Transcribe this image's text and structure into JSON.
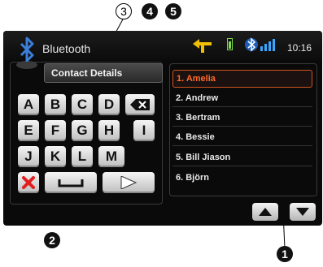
{
  "callouts": {
    "c1": "1",
    "c2": "2",
    "c3": "3",
    "c4": "4",
    "c5": "5"
  },
  "status_bar": {
    "title": "Bluetooth",
    "clock": "10:16",
    "icons": [
      "bluetooth-logo",
      "turn-arrow",
      "battery",
      "bluetooth-signal"
    ]
  },
  "header_field": "Contact Details",
  "keyboard": {
    "row1": [
      "A",
      "B",
      "C",
      "D"
    ],
    "row2": [
      "E",
      "F",
      "G",
      "H",
      "I"
    ],
    "row3": [
      "J",
      "K",
      "L",
      "M"
    ],
    "delete_icon": "backspace",
    "cancel_icon": "red-x",
    "space_icon": "space-bar",
    "enter_icon": "play-arrow"
  },
  "contacts": [
    "1. Amelia",
    "2. Andrew",
    "3. Bertram",
    "4. Bessie",
    "5. Bill Jiason",
    "6. Björn"
  ],
  "selected_contact_index": 0,
  "colors": {
    "accent": "#ff6a2a",
    "screen_bg": "#0a0a0a",
    "cancel_red": "#e21e1e",
    "signal_blue": "#3aa6ff",
    "battery_green": "#7fe04a",
    "turn_yellow": "#f0c000"
  }
}
